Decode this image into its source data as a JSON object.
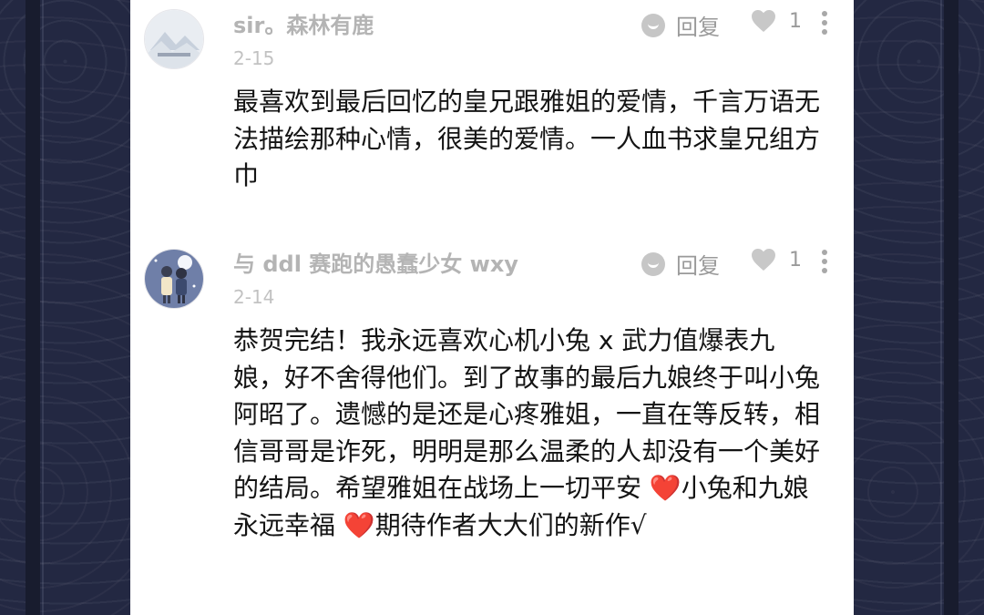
{
  "comments": [
    {
      "username": "sir。森林有鹿",
      "date": "2-15",
      "text": "最喜欢到最后回忆的皇兄跟雅姐的爱情，千言万语无法描绘那种心情，很美的爱情。一人血书求皇兄组方巾",
      "reply_label": "回复",
      "like_count": "1",
      "avatar_icon": "landscape-avatar-icon"
    },
    {
      "username": "与 ddl 赛跑的愚蠢少女 wxy",
      "date": "2-14",
      "text_parts": [
        "恭贺完结！我永远喜欢心机小兔 x 武力值爆表九娘，好不舍得他们。到了故事的最后九娘终于叫小兔阿昭了。遗憾的是还是心疼雅姐，一直在等反转，相信哥哥是诈死，明明是那么温柔的人却没有一个美好的结局。希望雅姐在战场上一切平安",
        "❤️",
        "小兔和九娘永远幸福",
        "❤️",
        "期待作者大大们的新作√"
      ],
      "reply_label": "回复",
      "like_count": "1",
      "avatar_icon": "anime-couple-avatar-icon"
    }
  ],
  "colors": {
    "background": "#1d2236",
    "panel": "#ffffff",
    "username": "#b4b4b4",
    "body_text": "#141414",
    "heart": "#d9312c"
  }
}
